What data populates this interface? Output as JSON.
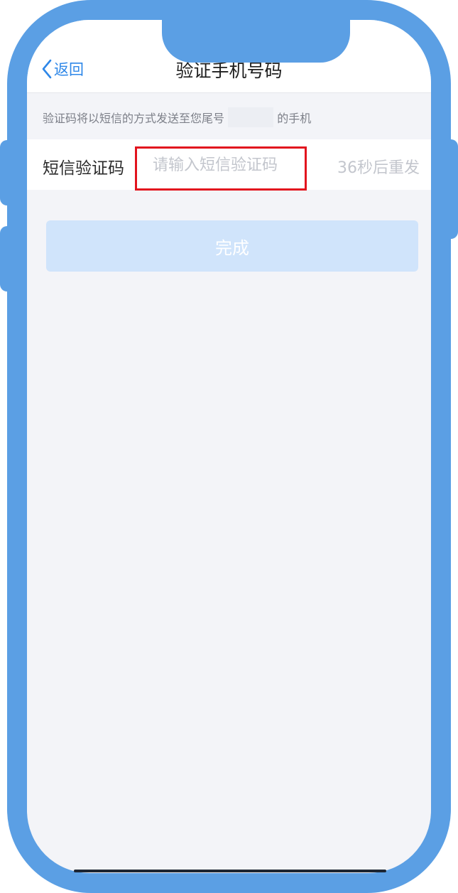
{
  "nav": {
    "back_label": "返回",
    "title": "验证手机号码"
  },
  "hint": {
    "text_before": "验证码将以短信的方式发送至您尾号",
    "text_after": "的手机"
  },
  "sms_code": {
    "label": "短信验证码",
    "placeholder": "请输入短信验证码",
    "value": "",
    "resend_countdown": "36秒后重发"
  },
  "actions": {
    "done_label": "完成"
  },
  "colors": {
    "frame": "#5b9fe4",
    "accent": "#2e87e8",
    "highlight": "#e2141e",
    "button_disabled": "#d0e4fb",
    "background": "#f3f4f8"
  }
}
